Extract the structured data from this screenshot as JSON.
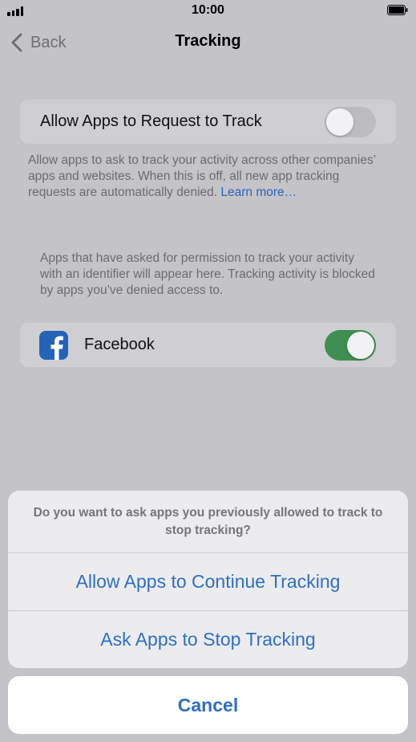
{
  "status_bar": {
    "time": "10:00"
  },
  "nav": {
    "back_label": "Back",
    "title": "Tracking"
  },
  "allow_tracking": {
    "label": "Allow Apps to Request to Track",
    "enabled": false,
    "footer": "Allow apps to ask to track your activity across other companies’ apps and websites. When this is off, all new app tracking requests are automatically denied. ",
    "footer_link": "Learn more…"
  },
  "apps_section": {
    "footer": "Apps that have asked for permission to track your activity with an identifier will appear here. Tracking activity is blocked by apps you’ve denied access to."
  },
  "apps": [
    {
      "name": "Facebook",
      "icon": "facebook-icon",
      "enabled": true
    }
  ],
  "action_sheet": {
    "message": "Do you want to ask apps you previously allowed to track to stop tracking?",
    "continue_label": "Allow Apps to Continue Tracking",
    "stop_label": "Ask Apps to Stop Tracking",
    "cancel_label": "Cancel"
  },
  "colors": {
    "accent": "#2f6fc4",
    "toggle_on": "#3e8f51",
    "facebook_blue": "#2463b8",
    "dim_background": "#c4c3c8"
  }
}
